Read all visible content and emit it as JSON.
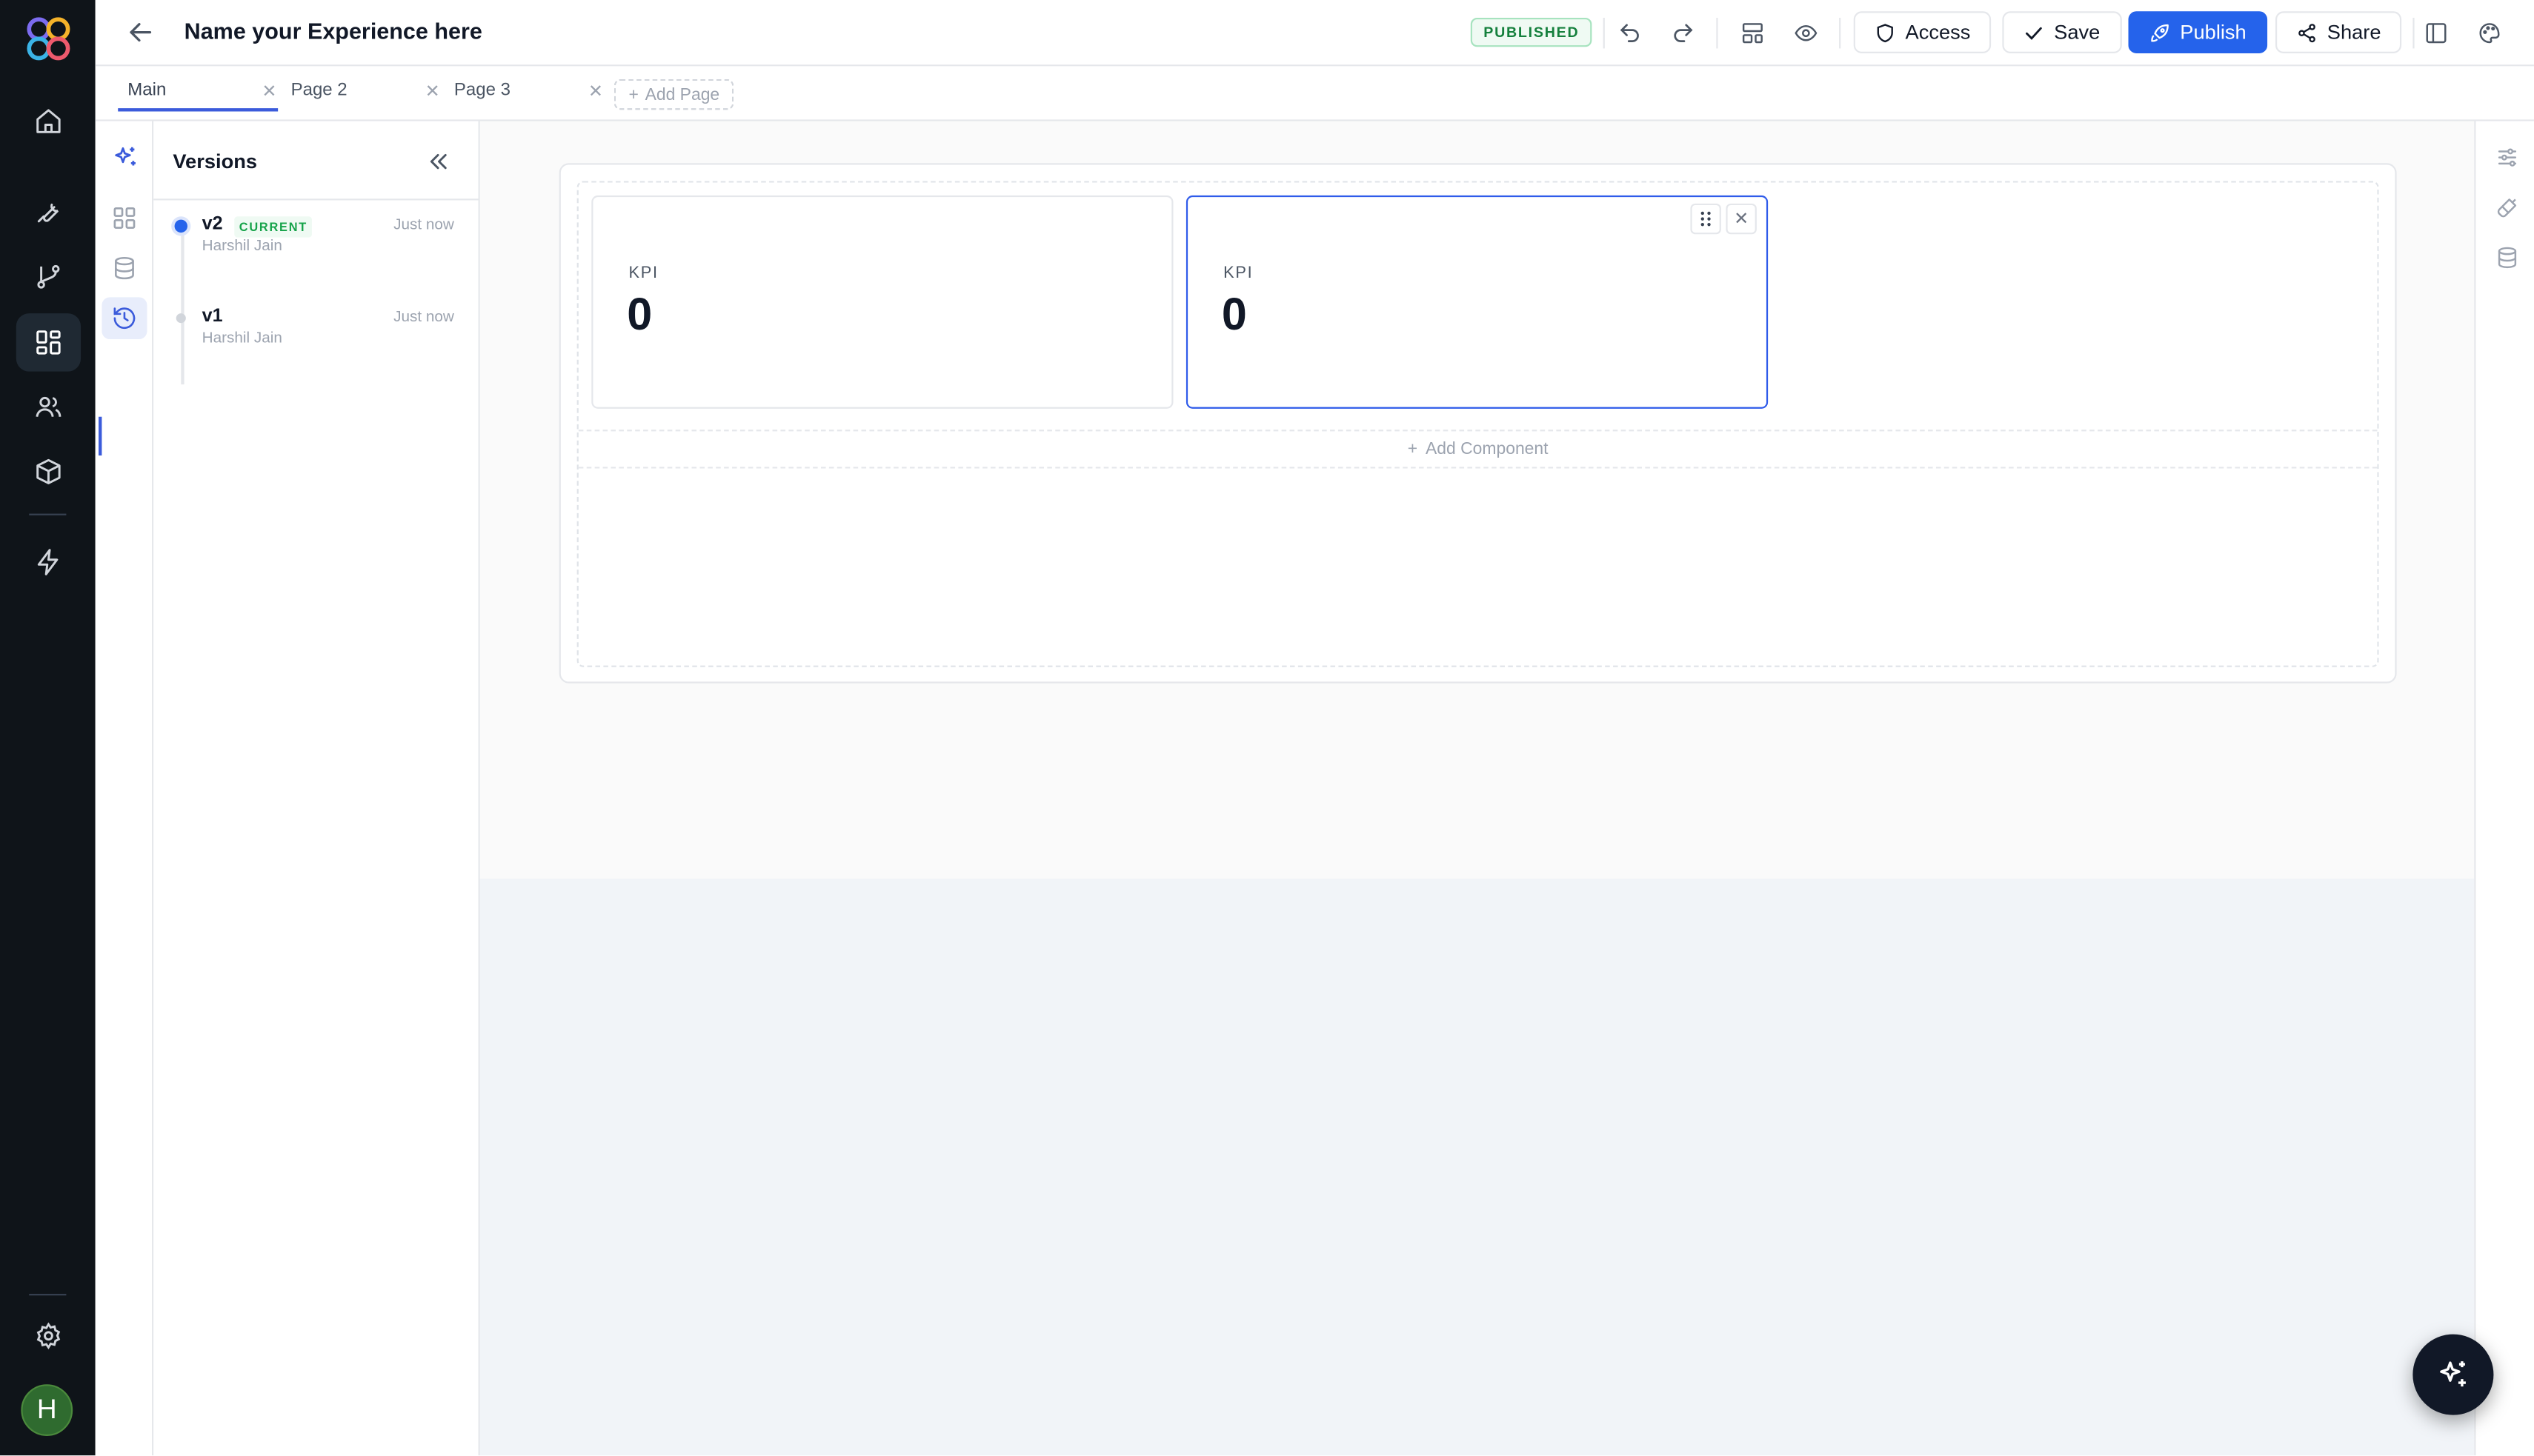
{
  "header": {
    "title": "Name your Experience here",
    "status_badge": "PUBLISHED",
    "access_label": "Access",
    "save_label": "Save",
    "publish_label": "Publish",
    "share_label": "Share"
  },
  "page_tabs": {
    "tabs": [
      {
        "label": "Main",
        "active": true
      },
      {
        "label": "Page 2",
        "active": false
      },
      {
        "label": "Page 3",
        "active": false
      }
    ],
    "add_page_label": "Add Page"
  },
  "versions_panel": {
    "title": "Versions",
    "items": [
      {
        "version": "v2",
        "tag": "CURRENT",
        "author": "Harshil Jain",
        "time": "Just now"
      },
      {
        "version": "v1",
        "tag": "",
        "author": "Harshil Jain",
        "time": "Just now"
      }
    ]
  },
  "canvas": {
    "kpi_cards": [
      {
        "label": "KPI",
        "value": "0",
        "selected": false
      },
      {
        "label": "KPI",
        "value": "0",
        "selected": true
      }
    ],
    "add_component_label": "Add Component"
  },
  "user": {
    "avatar_initial": "H"
  },
  "colors": {
    "accent": "#2563eb",
    "rail_bg": "#0f1419",
    "published_green": "#15803d",
    "selection_blue": "#2f5bea"
  },
  "icons": {
    "left_rail": [
      "home-icon",
      "wrench-icon",
      "git-branch-icon",
      "dashboard-icon",
      "users-icon",
      "box-icon",
      "lightning-icon",
      "settings-icon"
    ],
    "toolbar": [
      "undo-icon",
      "redo-icon",
      "layout-icon",
      "eye-icon",
      "sidebar-icon",
      "palette-icon"
    ],
    "strip": [
      "sparkles-icon",
      "grid-icon",
      "database-icon",
      "history-icon"
    ],
    "right_rail": [
      "sliders-icon",
      "paintbrush-icon",
      "database-icon"
    ]
  }
}
